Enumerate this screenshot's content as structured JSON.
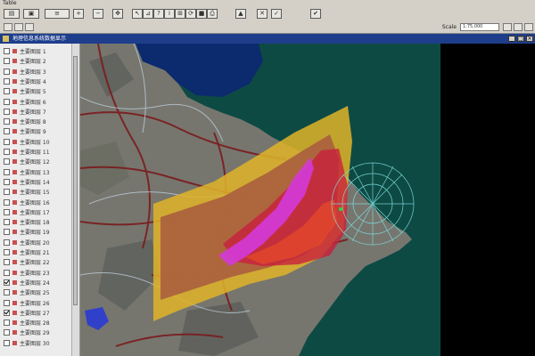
{
  "menubar": {
    "label": "Table"
  },
  "toolbar": {
    "buttons": [
      {
        "name": "file-button",
        "glyph": "▤"
      },
      {
        "name": "save-button",
        "glyph": "▣"
      },
      {
        "name": "layer-button",
        "glyph": "≡"
      },
      {
        "name": "zoom-in-button",
        "glyph": "+"
      },
      {
        "name": "zoom-out-button",
        "glyph": "−"
      },
      {
        "name": "pan-button",
        "glyph": "✥"
      },
      {
        "name": "select-button",
        "glyph": "↖"
      },
      {
        "name": "measure-button",
        "glyph": "⊿"
      },
      {
        "name": "query-button",
        "glyph": "?"
      },
      {
        "name": "identify-button",
        "glyph": "i"
      },
      {
        "name": "full-extent-button",
        "glyph": "⊞"
      },
      {
        "name": "refresh-button",
        "glyph": "⟳"
      },
      {
        "name": "stop-button",
        "glyph": "■"
      },
      {
        "name": "print-button",
        "glyph": "⎙"
      },
      {
        "name": "warning-button",
        "glyph": "▲"
      },
      {
        "name": "close-panel-button",
        "glyph": "✕"
      },
      {
        "name": "check-button",
        "glyph": "✓"
      },
      {
        "name": "approve-button",
        "glyph": "✔"
      }
    ]
  },
  "status": {
    "scale_label": "Scale",
    "scale_value": "1:75,000"
  },
  "window": {
    "title": "地理信息系统数据显示"
  },
  "layers": [
    {
      "label": "主要图层 1",
      "checked": false
    },
    {
      "label": "主要图层 2",
      "checked": false
    },
    {
      "label": "主要图层 3",
      "checked": false
    },
    {
      "label": "主要图层 4",
      "checked": false
    },
    {
      "label": "主要图层 5",
      "checked": false
    },
    {
      "label": "主要图层 6",
      "checked": false
    },
    {
      "label": "主要图层 7",
      "checked": false
    },
    {
      "label": "主要图层 8",
      "checked": false
    },
    {
      "label": "主要图层 9",
      "checked": false
    },
    {
      "label": "主要图层 10",
      "checked": false
    },
    {
      "label": "主要图层 11",
      "checked": false
    },
    {
      "label": "主要图层 12",
      "checked": false
    },
    {
      "label": "主要图层 13",
      "checked": false
    },
    {
      "label": "主要图层 14",
      "checked": false
    },
    {
      "label": "主要图层 15",
      "checked": false
    },
    {
      "label": "主要图层 16",
      "checked": false
    },
    {
      "label": "主要图层 17",
      "checked": false
    },
    {
      "label": "主要图层 18",
      "checked": false
    },
    {
      "label": "主要图层 19",
      "checked": false
    },
    {
      "label": "主要图层 20",
      "checked": false
    },
    {
      "label": "主要图层 21",
      "checked": false
    },
    {
      "label": "主要图层 22",
      "checked": false
    },
    {
      "label": "主要图层 23",
      "checked": false
    },
    {
      "label": "主要图层 24",
      "checked": true
    },
    {
      "label": "主要图层 25",
      "checked": false
    },
    {
      "label": "主要图层 26",
      "checked": false
    },
    {
      "label": "主要图层 27",
      "checked": true
    },
    {
      "label": "主要图层 28",
      "checked": false
    },
    {
      "label": "主要图层 29",
      "checked": false
    },
    {
      "label": "主要图层 30",
      "checked": false
    }
  ],
  "colors": {
    "sea": "#0e4a44",
    "land": "#7a7a78",
    "roads": "#7a1c1c",
    "hazard_outer": "#e0b428",
    "hazard_middle": "#b05a3c",
    "hazard_inner": "#c8203c",
    "hazard_core": "#d43ad8",
    "grid": "#7fe0e0"
  }
}
